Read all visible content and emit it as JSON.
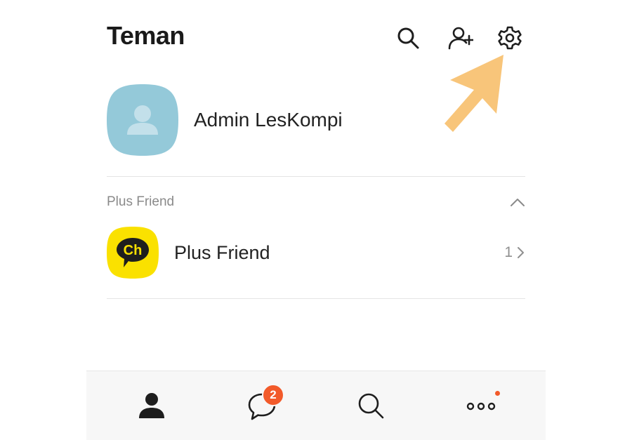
{
  "header": {
    "title": "Teman",
    "icons": [
      "search-icon",
      "add-friend-icon",
      "settings-icon"
    ]
  },
  "profile": {
    "name": "Admin LesKompi",
    "avatar_color": "#94c9d9"
  },
  "section": {
    "label": "Plus Friend",
    "toggle_icon": "chevron-up-icon"
  },
  "plus_friend": {
    "name": "Plus Friend",
    "count": "1",
    "logo_text": "Ch",
    "logo_color": "#fae100"
  },
  "tabbar": {
    "tabs": [
      "friends-tab-icon",
      "chats-tab-icon",
      "search-tab-icon",
      "more-tab-icon"
    ],
    "chats_badge": "2"
  },
  "colors": {
    "accent": "#f25a2a",
    "arrow": "#f8c57a"
  }
}
